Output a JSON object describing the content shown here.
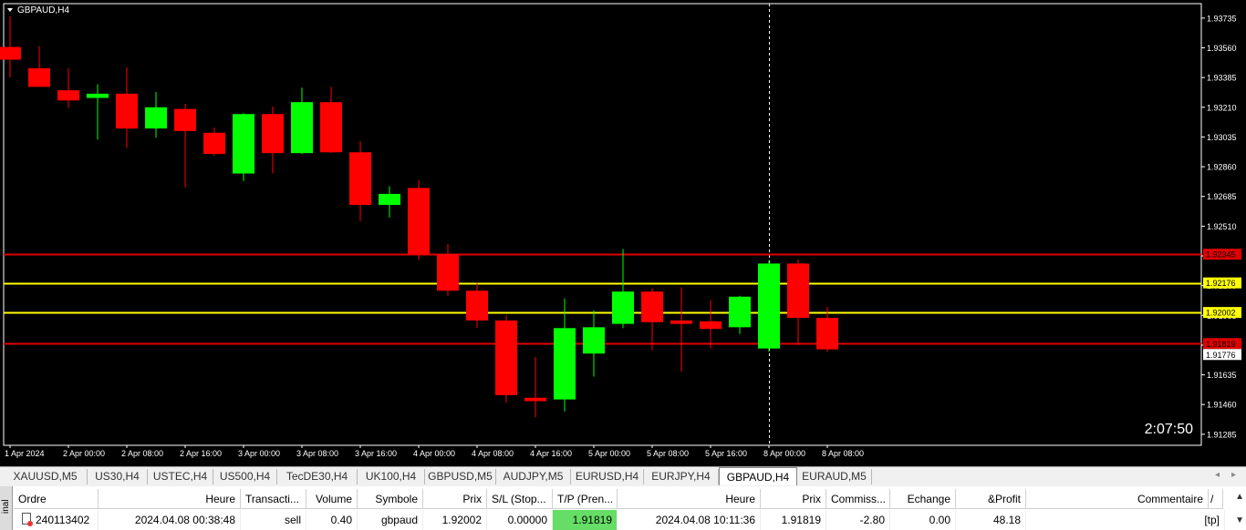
{
  "chart_data": {
    "type": "candlestick",
    "title": "GBPAUD,H4",
    "symbol": "GBPAUD",
    "timeframe": "H4",
    "ylim": [
      1.9122,
      1.9382
    ],
    "y_ticks": [
      "1.93735",
      "1.93560",
      "1.93385",
      "1.93210",
      "1.93035",
      "1.92860",
      "1.92685",
      "1.92510",
      "1.92335",
      "1.92160",
      "1.91985",
      "1.91810",
      "1.91635",
      "1.91460",
      "1.91285"
    ],
    "x_ticks": [
      {
        "label": "1 Apr 2024",
        "index": 0
      },
      {
        "label": "2 Apr 00:00",
        "index": 2
      },
      {
        "label": "2 Apr 08:00",
        "index": 4
      },
      {
        "label": "2 Apr 16:00",
        "index": 6
      },
      {
        "label": "3 Apr 00:00",
        "index": 8
      },
      {
        "label": "3 Apr 08:00",
        "index": 10
      },
      {
        "label": "3 Apr 16:00",
        "index": 12
      },
      {
        "label": "4 Apr 00:00",
        "index": 14
      },
      {
        "label": "4 Apr 08:00",
        "index": 16
      },
      {
        "label": "4 Apr 16:00",
        "index": 18
      },
      {
        "label": "5 Apr 00:00",
        "index": 20
      },
      {
        "label": "5 Apr 08:00",
        "index": 22
      },
      {
        "label": "5 Apr 16:00",
        "index": 24
      },
      {
        "label": "8 Apr 00:00",
        "index": 26
      },
      {
        "label": "8 Apr 08:00",
        "index": 28
      }
    ],
    "candles": [
      {
        "o": 1.93565,
        "h": 1.93745,
        "l": 1.93385,
        "c": 1.9349
      },
      {
        "o": 1.9344,
        "h": 1.9357,
        "l": 1.9338,
        "c": 1.9333
      },
      {
        "o": 1.9331,
        "h": 1.9344,
        "l": 1.93205,
        "c": 1.9325
      },
      {
        "o": 1.93265,
        "h": 1.93345,
        "l": 1.9302,
        "c": 1.9329
      },
      {
        "o": 1.9329,
        "h": 1.93445,
        "l": 1.9297,
        "c": 1.93085
      },
      {
        "o": 1.93085,
        "h": 1.933,
        "l": 1.9303,
        "c": 1.9321
      },
      {
        "o": 1.932,
        "h": 1.9323,
        "l": 1.9274,
        "c": 1.9307
      },
      {
        "o": 1.9306,
        "h": 1.9309,
        "l": 1.92925,
        "c": 1.92935
      },
      {
        "o": 1.9282,
        "h": 1.93175,
        "l": 1.92775,
        "c": 1.9317
      },
      {
        "o": 1.9317,
        "h": 1.93215,
        "l": 1.9282,
        "c": 1.9294
      },
      {
        "o": 1.9294,
        "h": 1.93325,
        "l": 1.92935,
        "c": 1.9324
      },
      {
        "o": 1.9324,
        "h": 1.9333,
        "l": 1.9294,
        "c": 1.92945
      },
      {
        "o": 1.92945,
        "h": 1.9301,
        "l": 1.9254,
        "c": 1.92635
      },
      {
        "o": 1.92635,
        "h": 1.92745,
        "l": 1.9256,
        "c": 1.927
      },
      {
        "o": 1.92735,
        "h": 1.9278,
        "l": 1.9231,
        "c": 1.92345
      },
      {
        "o": 1.92345,
        "h": 1.92405,
        "l": 1.921,
        "c": 1.9213
      },
      {
        "o": 1.9213,
        "h": 1.92175,
        "l": 1.9191,
        "c": 1.91955
      },
      {
        "o": 1.91955,
        "h": 1.91985,
        "l": 1.9147,
        "c": 1.91515
      },
      {
        "o": 1.915,
        "h": 1.9174,
        "l": 1.91385,
        "c": 1.9148
      },
      {
        "o": 1.9149,
        "h": 1.92085,
        "l": 1.9142,
        "c": 1.9191
      },
      {
        "o": 1.9176,
        "h": 1.92015,
        "l": 1.91625,
        "c": 1.91915
      },
      {
        "o": 1.91935,
        "h": 1.92375,
        "l": 1.9191,
        "c": 1.92125
      },
      {
        "o": 1.92125,
        "h": 1.92145,
        "l": 1.9178,
        "c": 1.91945
      },
      {
        "o": 1.91955,
        "h": 1.9215,
        "l": 1.91655,
        "c": 1.91935
      },
      {
        "o": 1.9195,
        "h": 1.92075,
        "l": 1.9179,
        "c": 1.91905
      },
      {
        "o": 1.91915,
        "h": 1.921,
        "l": 1.91875,
        "c": 1.92095
      },
      {
        "o": 1.9179,
        "h": 1.9231,
        "l": 1.9177,
        "c": 1.9229
      },
      {
        "o": 1.9229,
        "h": 1.92315,
        "l": 1.9181,
        "c": 1.9197
      },
      {
        "o": 1.9197,
        "h": 1.92035,
        "l": 1.9177,
        "c": 1.91785
      }
    ],
    "levels": [
      {
        "price": 1.92345,
        "color": "#e00000",
        "label": "1.92345"
      },
      {
        "price": 1.92176,
        "color": "#ffff00",
        "label": "1.92176"
      },
      {
        "price": 1.92002,
        "color": "#ffff00",
        "label": "1.92002"
      },
      {
        "price": 1.91819,
        "color": "#e00000",
        "label": "1.91819"
      }
    ],
    "bid_label": "1.91776",
    "crosshair_index": 26,
    "countdown": "2:07:50",
    "colors": {
      "bg": "#000000",
      "bull": "#00ff00",
      "bear": "#ff0000",
      "text": "#ffffff",
      "grid": "#ffffff"
    }
  },
  "tabs": {
    "items": [
      "XAUUSD,M5",
      "US30,H4",
      "USTEC,H4",
      "US500,H4",
      "TecDE30,H4",
      "UK100,H4",
      "GBPUSD,M5",
      "AUDJPY,M5",
      "EURUSD,H4",
      "EURJPY,H4",
      "GBPAUD,H4",
      "EURAUD,M5"
    ],
    "active_index": 10
  },
  "terminal": {
    "side_label": "inal",
    "headers": {
      "ordre": "Ordre",
      "heure": "Heure",
      "transaction": "Transacti...",
      "volume": "Volume",
      "symbole": "Symbole",
      "prix": "Prix",
      "sl": "S/L (Stop...",
      "tp": "T/P (Pren...",
      "heure2": "Heure",
      "prix2": "Prix",
      "commission": "Commiss...",
      "echange": "Echange",
      "profit": "&Profit",
      "commentaire": "Commentaire"
    },
    "row": {
      "ordre": "240113402",
      "heure": "2024.04.08 00:38:48",
      "transaction": "sell",
      "volume": "0.40",
      "symbole": "gbpaud",
      "prix": "1.92002",
      "sl": "0.00000",
      "tp": "1.91819",
      "heure2": "2024.04.08 10:11:36",
      "prix2": "1.91819",
      "commission": "-2.80",
      "echange": "0.00",
      "profit": "48.18",
      "commentaire": "[tp]"
    }
  }
}
